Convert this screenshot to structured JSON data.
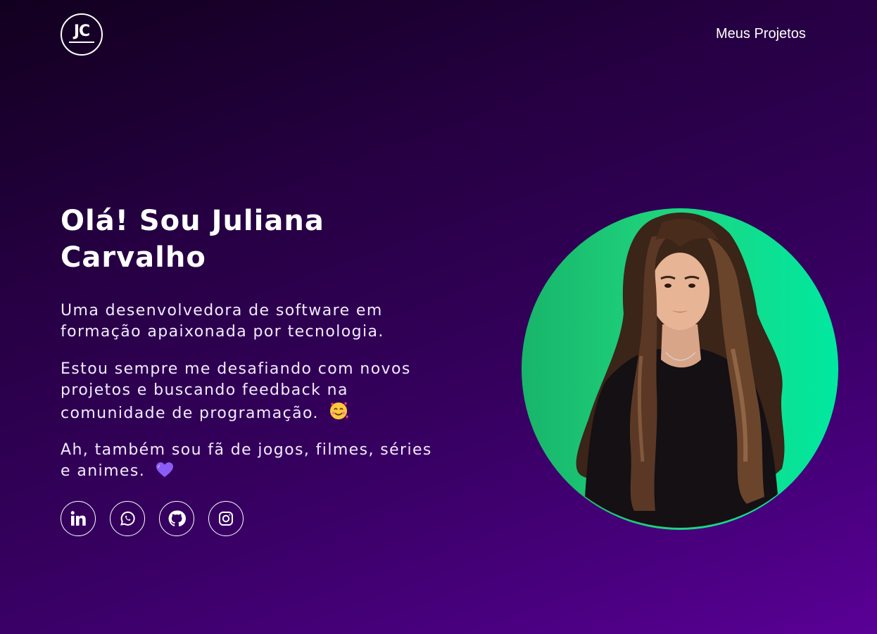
{
  "header": {
    "logo_text": "JC",
    "nav_link": "Meus Projetos"
  },
  "hero": {
    "title": "Olá! Sou Juliana Carvalho",
    "paragraph_1": "Uma desenvolvedora de software em formação apaixonada por tecnologia.",
    "paragraph_2": "Estou sempre me desafiando com novos projetos e buscando feedback na comunidade de programação.",
    "paragraph_3": "Ah, também sou fã de jogos, filmes, séries e animes."
  },
  "socials": [
    {
      "icon": "linkedin-icon"
    },
    {
      "icon": "whatsapp-icon"
    },
    {
      "icon": "github-icon"
    },
    {
      "icon": "instagram-icon"
    }
  ],
  "colors": {
    "background_start": "#12001f",
    "background_end": "#5a0096",
    "photo_circle_start": "#18b56a",
    "photo_circle_end": "#00e8a0",
    "text": "#ffffff"
  }
}
